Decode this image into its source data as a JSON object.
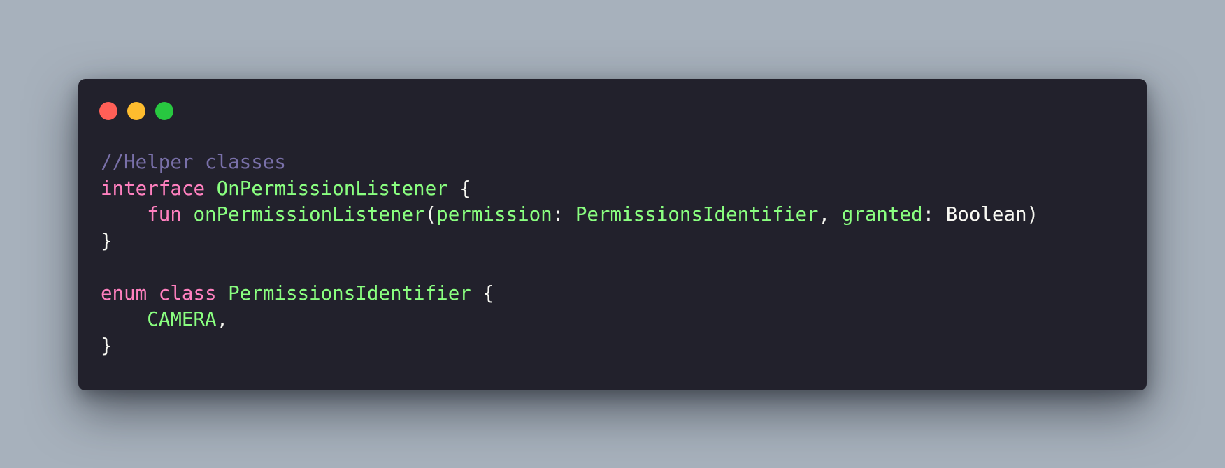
{
  "window": {
    "controls": [
      {
        "name": "close",
        "color": "#ff5f57"
      },
      {
        "name": "minimize",
        "color": "#febc2e"
      },
      {
        "name": "zoom",
        "color": "#28c840"
      }
    ]
  },
  "code": {
    "lines": [
      [
        {
          "t": "//Helper classes",
          "k": "comment"
        }
      ],
      [
        {
          "t": "interface",
          "k": "keyword"
        },
        {
          "t": " ",
          "k": "plain"
        },
        {
          "t": "OnPermissionListener",
          "k": "type"
        },
        {
          "t": " {",
          "k": "plain"
        }
      ],
      [
        {
          "t": "    ",
          "k": "plain"
        },
        {
          "t": "fun",
          "k": "keyword"
        },
        {
          "t": " ",
          "k": "plain"
        },
        {
          "t": "onPermissionListener",
          "k": "fn"
        },
        {
          "t": "(",
          "k": "plain"
        },
        {
          "t": "permission",
          "k": "param"
        },
        {
          "t": ": ",
          "k": "plain"
        },
        {
          "t": "PermissionsIdentifier",
          "k": "type"
        },
        {
          "t": ", ",
          "k": "plain"
        },
        {
          "t": "granted",
          "k": "param"
        },
        {
          "t": ": Boolean)",
          "k": "plain"
        }
      ],
      [
        {
          "t": "}",
          "k": "plain"
        }
      ],
      [],
      [
        {
          "t": "enum",
          "k": "keyword"
        },
        {
          "t": " ",
          "k": "plain"
        },
        {
          "t": "class",
          "k": "keyword"
        },
        {
          "t": " ",
          "k": "plain"
        },
        {
          "t": "PermissionsIdentifier",
          "k": "type"
        },
        {
          "t": " {",
          "k": "plain"
        }
      ],
      [
        {
          "t": "    ",
          "k": "plain"
        },
        {
          "t": "CAMERA",
          "k": "type"
        },
        {
          "t": ",",
          "k": "plain"
        }
      ],
      [
        {
          "t": "}",
          "k": "plain"
        }
      ]
    ]
  }
}
